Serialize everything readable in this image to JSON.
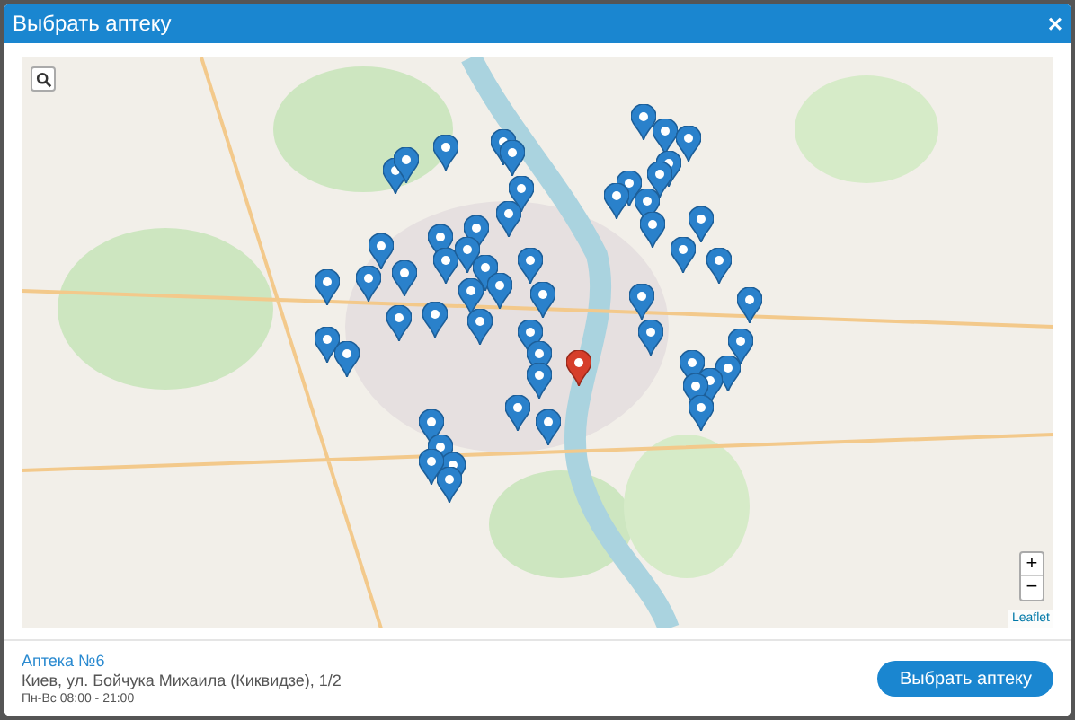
{
  "dialog": {
    "title": "Выбрать аптеку",
    "close": "×"
  },
  "map": {
    "zoom_in": "+",
    "zoom_out": "−",
    "attribution": "Leaflet"
  },
  "pharmacy": {
    "name": "Аптека №6",
    "address": "Киев, ул. Бойчука Михаила (Киквидзе), 1/2",
    "hours": "Пн-Вс 08:00 - 21:00"
  },
  "buttons": [
    {
      "label": "Выбрать аптеку"
    }
  ]
}
